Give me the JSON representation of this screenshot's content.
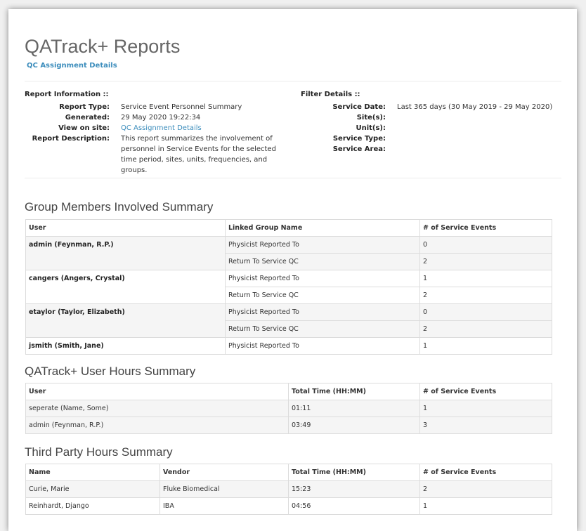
{
  "page": {
    "title": "QATrack+ Reports",
    "subtitle": "QC Assignment Details"
  },
  "report_info": {
    "heading": "Report Information ::",
    "rows": [
      {
        "label": "Report Type:",
        "value": "Service Event Personnel Summary"
      },
      {
        "label": "Generated:",
        "value": "29 May 2020 19:22:34"
      },
      {
        "label": "View on site:",
        "value": "QC Assignment Details",
        "is_link": true
      },
      {
        "label": "Report Description:",
        "value": "This report summarizes the involvement of personnel in Service Events for the selected time period, sites, units, frequencies, and groups."
      }
    ]
  },
  "filter_details": {
    "heading": "Filter Details ::",
    "rows": [
      {
        "label": "Service Date:",
        "value": "Last 365 days (30 May 2019 - 29 May 2020)"
      },
      {
        "label": "Site(s):",
        "value": ""
      },
      {
        "label": "Unit(s):",
        "value": ""
      },
      {
        "label": "Service Type:",
        "value": ""
      },
      {
        "label": "Service Area:",
        "value": ""
      }
    ]
  },
  "group_summary": {
    "title": "Group Members Involved Summary",
    "columns": [
      "User",
      "Linked Group Name",
      "# of Service Events"
    ],
    "groups": [
      {
        "user": "admin (Feynman, R.P.)",
        "rows": [
          {
            "group": "Physicist Reported To",
            "count": "0"
          },
          {
            "group": "Return To Service QC",
            "count": "2"
          }
        ]
      },
      {
        "user": "cangers (Angers, Crystal)",
        "rows": [
          {
            "group": "Physicist Reported To",
            "count": "1"
          },
          {
            "group": "Return To Service QC",
            "count": "2"
          }
        ]
      },
      {
        "user": "etaylor (Taylor, Elizabeth)",
        "rows": [
          {
            "group": "Physicist Reported To",
            "count": "0"
          },
          {
            "group": "Return To Service QC",
            "count": "2"
          }
        ]
      },
      {
        "user": "jsmith (Smith, Jane)",
        "rows": [
          {
            "group": "Physicist Reported To",
            "count": "1"
          }
        ]
      }
    ]
  },
  "user_hours": {
    "title": "QATrack+ User Hours Summary",
    "columns": [
      "User",
      "Total Time (HH:MM)",
      "# of Service Events"
    ],
    "rows": [
      {
        "user": "seperate (Name, Some)",
        "time": "01:11",
        "count": "1"
      },
      {
        "user": "admin (Feynman, R.P.)",
        "time": "03:49",
        "count": "3"
      }
    ]
  },
  "third_party": {
    "title": "Third Party Hours Summary",
    "columns": [
      "Name",
      "Vendor",
      "Total Time (HH:MM)",
      "# of Service Events"
    ],
    "rows": [
      {
        "name": "Curie, Marie",
        "vendor": "Fluke Biomedical",
        "time": "15:23",
        "count": "2"
      },
      {
        "name": "Reinhardt, Django",
        "vendor": "IBA",
        "time": "04:56",
        "count": "1"
      }
    ]
  },
  "colors": {
    "link": "#3c8dbc",
    "row_shade": "#f5f5f5"
  }
}
